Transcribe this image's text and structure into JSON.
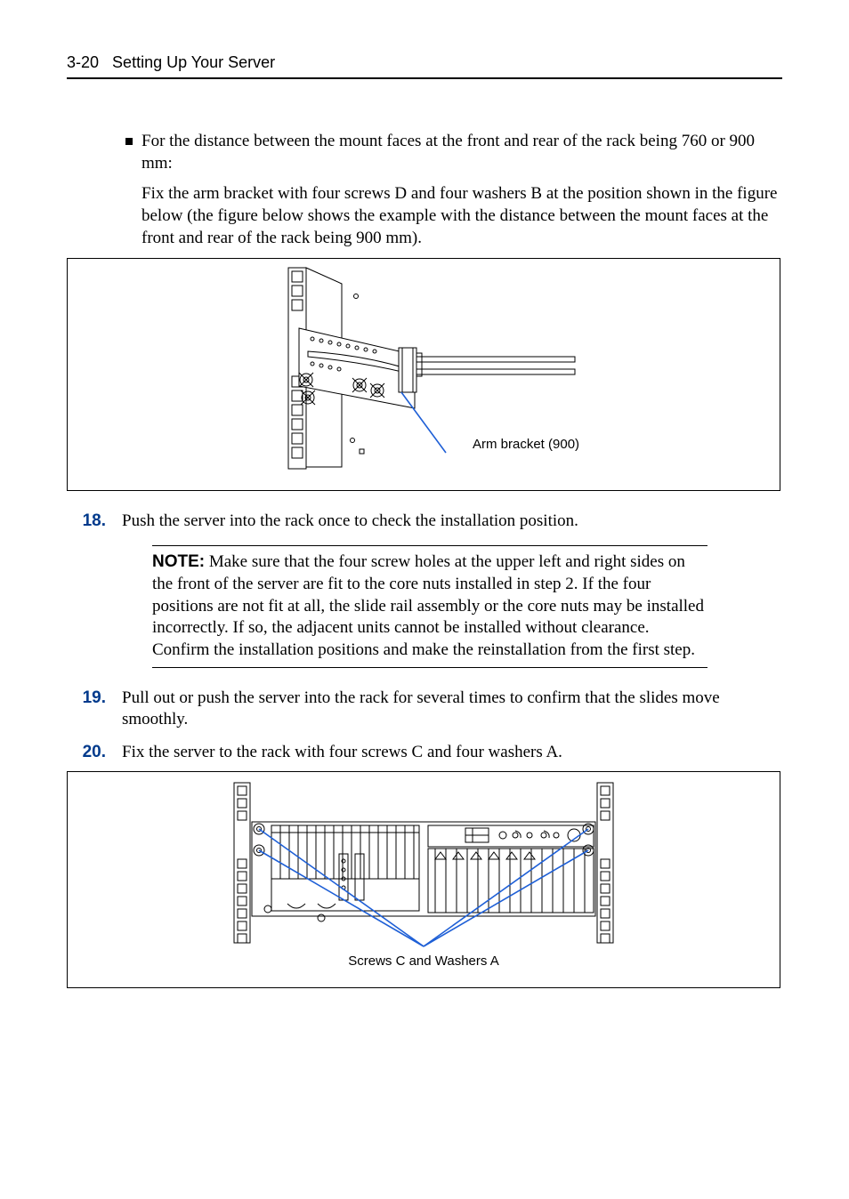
{
  "header": {
    "page_number": "3-20",
    "section_title": "Setting Up Your Server"
  },
  "bullet": {
    "text": "For the distance between the mount faces at the front and rear of the rack being 760 or 900 mm:"
  },
  "sub_paragraph": "Fix the arm bracket with four screws D and four washers B at the position shown in the figure below (the figure below shows the example with the distance between the mount faces at the front and rear of the rack being 900 mm).",
  "figure1": {
    "caption": "Arm bracket (900)"
  },
  "steps": [
    {
      "num": "18.",
      "text": "Push the server into the rack once to check the installation position."
    },
    {
      "num": "19.",
      "text": "Pull out or push the server into the rack for several times to confirm that the slides move smoothly."
    },
    {
      "num": "20.",
      "text": "Fix the server to the rack with four screws C and four washers A."
    }
  ],
  "note": {
    "label": "NOTE:",
    "text": " Make sure that the four screw holes at the upper left and right sides on the front of the server are fit to the core nuts installed in step 2. If the four positions are not fit at all, the slide rail assembly or the core nuts may be installed incorrectly. If so, the adjacent units cannot be installed without clearance. Confirm the installation positions and make the reinstallation from the first step."
  },
  "figure2": {
    "caption": "Screws C and Washers A"
  }
}
